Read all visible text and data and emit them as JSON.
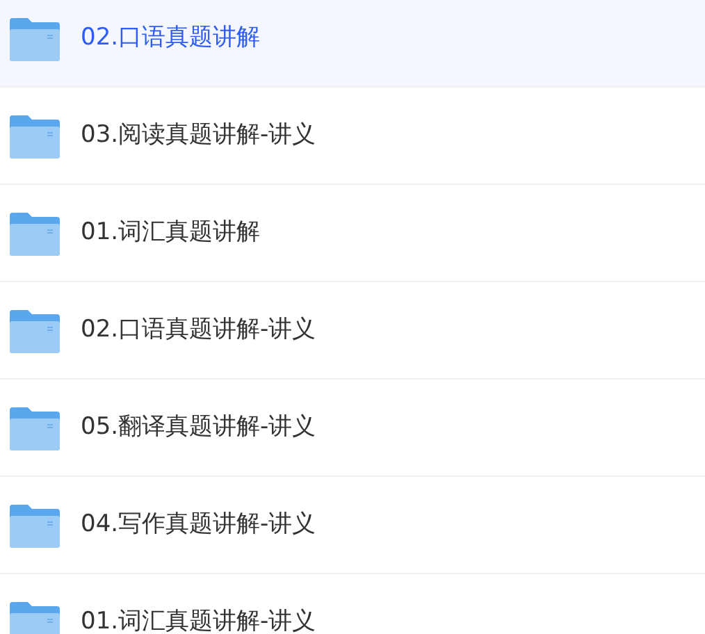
{
  "files": [
    {
      "name": "02.口语真题讲解",
      "selected": true
    },
    {
      "name": "03.阅读真题讲解-讲义",
      "selected": false
    },
    {
      "name": "01.词汇真题讲解",
      "selected": false
    },
    {
      "name": "02.口语真题讲解-讲义",
      "selected": false
    },
    {
      "name": "05.翻译真题讲解-讲义",
      "selected": false
    },
    {
      "name": "04.写作真题讲解-讲义",
      "selected": false
    },
    {
      "name": "01.词汇真题讲解-讲义",
      "selected": false
    }
  ]
}
